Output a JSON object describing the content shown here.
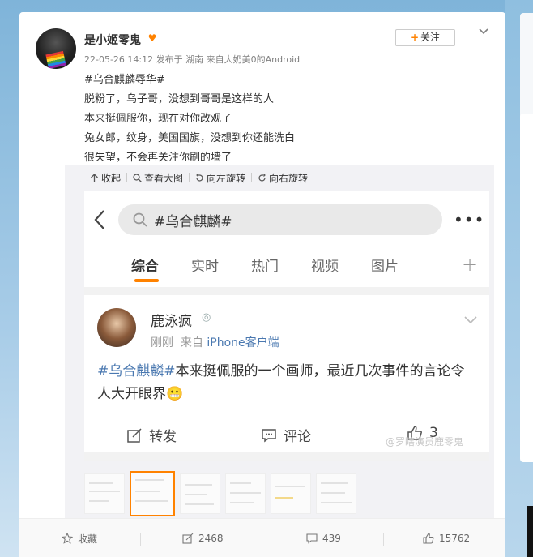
{
  "post": {
    "username": "是小姬零鬼",
    "vip_icon": "heart-emoji-badge",
    "follow_label": "关注",
    "meta": "22-05-26 14:12 发布于 湖南 来自大奶美0的Android",
    "lines": [
      "#乌合麒麟辱华#",
      "脱粉了，乌子哥，没想到哥哥是这样的人",
      "本来挺佩服你，现在对你改观了",
      "兔女郎，纹身，美国国旗，没想到你还能洗白",
      "很失望，不会再关注你刷的墙了"
    ]
  },
  "media_toolbar": {
    "collapse": "收起",
    "view_large": "查看大图",
    "rotate_left": "向左旋转",
    "rotate_right": "向右旋转"
  },
  "screenshot": {
    "search_query": "#乌合麒麟#",
    "tabs": [
      "综合",
      "实时",
      "热门",
      "视频",
      "图片"
    ],
    "active_tab": "综合",
    "post": {
      "name": "鹿泳疯",
      "time": "刚刚",
      "source_prefix": "来自",
      "source": "iPhone客户端",
      "hashtag": "#乌合麒麟#",
      "text": "本来挺佩服的一个画师，最近几次事件的言论令人大开眼界",
      "emoji": "😬",
      "repost": "转发",
      "comment": "评论",
      "likes": "3"
    },
    "watermark": "@罗瞎演员鹿零鬼"
  },
  "footer": {
    "favorite": "收藏",
    "reposts": "2468",
    "comments": "439",
    "likes": "15762"
  },
  "colors": {
    "accent": "#ff8200",
    "link": "#4a78b0",
    "background": "#8fbfe0"
  }
}
